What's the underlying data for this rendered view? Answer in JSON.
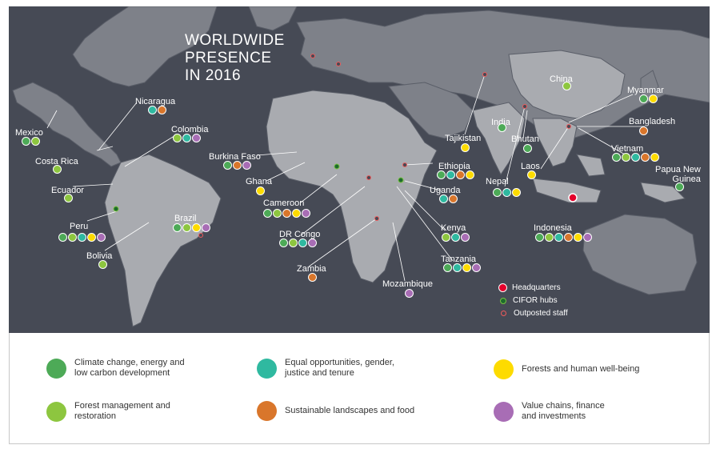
{
  "title": "WORLDWIDE\nPRESENCE\nIN 2016",
  "colors": {
    "climate": "#4daa57",
    "equal": "#2fb9a0",
    "wellbeing": "#fddb00",
    "forest": "#8dc63f",
    "landscapes": "#d9762b",
    "value": "#a86db5",
    "hq": "#e4002b"
  },
  "countries": [
    {
      "name": "Mexico",
      "themes": [
        "climate",
        "forest"
      ]
    },
    {
      "name": "Nicaragua",
      "themes": [
        "equal",
        "landscapes"
      ]
    },
    {
      "name": "Colombia",
      "themes": [
        "forest",
        "equal",
        "value"
      ]
    },
    {
      "name": "Costa Rica",
      "themes": [
        "forest"
      ]
    },
    {
      "name": "Ecuador",
      "themes": [
        "forest"
      ]
    },
    {
      "name": "Peru",
      "themes": [
        "climate",
        "forest",
        "equal",
        "wellbeing",
        "value"
      ]
    },
    {
      "name": "Bolivia",
      "themes": [
        "forest"
      ]
    },
    {
      "name": "Brazil",
      "themes": [
        "climate",
        "forest",
        "wellbeing",
        "value"
      ]
    },
    {
      "name": "Burkina Faso",
      "themes": [
        "climate",
        "landscapes",
        "value"
      ]
    },
    {
      "name": "Ghana",
      "themes": [
        "wellbeing"
      ]
    },
    {
      "name": "Cameroon",
      "themes": [
        "climate",
        "forest",
        "landscapes",
        "wellbeing",
        "value"
      ]
    },
    {
      "name": "DR Congo",
      "themes": [
        "climate",
        "forest",
        "equal",
        "value"
      ]
    },
    {
      "name": "Zambia",
      "themes": [
        "landscapes"
      ]
    },
    {
      "name": "Mozambique",
      "themes": [
        "value"
      ]
    },
    {
      "name": "Ethiopia",
      "themes": [
        "climate",
        "equal",
        "landscapes",
        "wellbeing"
      ]
    },
    {
      "name": "Uganda",
      "themes": [
        "equal",
        "landscapes"
      ]
    },
    {
      "name": "Kenya",
      "themes": [
        "forest",
        "equal",
        "value"
      ]
    },
    {
      "name": "Tanzania",
      "themes": [
        "climate",
        "equal",
        "wellbeing",
        "value"
      ]
    },
    {
      "name": "Tajikistan",
      "themes": [
        "wellbeing"
      ]
    },
    {
      "name": "India",
      "themes": [
        "climate"
      ]
    },
    {
      "name": "Nepal",
      "themes": [
        "climate",
        "equal",
        "wellbeing"
      ]
    },
    {
      "name": "Bhutan",
      "themes": [
        "climate"
      ]
    },
    {
      "name": "China",
      "themes": [
        "forest"
      ]
    },
    {
      "name": "Myanmar",
      "themes": [
        "climate",
        "wellbeing"
      ]
    },
    {
      "name": "Bangladesh",
      "themes": [
        "landscapes"
      ]
    },
    {
      "name": "Laos",
      "themes": [
        "wellbeing"
      ]
    },
    {
      "name": "Vietnam",
      "themes": [
        "climate",
        "forest",
        "equal",
        "landscapes",
        "wellbeing"
      ]
    },
    {
      "name": "Papua New\nGuinea",
      "themes": [
        "climate"
      ]
    },
    {
      "name": "Indonesia",
      "themes": [
        "climate",
        "forest",
        "equal",
        "landscapes",
        "wellbeing",
        "value"
      ]
    }
  ],
  "map_legend": {
    "hq": "Headquarters",
    "hubs": "CIFOR hubs",
    "staff": "Outposted staff"
  },
  "themes_legend": [
    {
      "key": "climate",
      "label": "Climate change, energy and\nlow carbon development"
    },
    {
      "key": "equal",
      "label": "Equal opportunities, gender,\njustice and tenure"
    },
    {
      "key": "wellbeing",
      "label": "Forests and human well-being"
    },
    {
      "key": "forest",
      "label": "Forest management and\nrestoration"
    },
    {
      "key": "landscapes",
      "label": "Sustainable landscapes and food"
    },
    {
      "key": "value",
      "label": "Value chains, finance\nand investments"
    }
  ]
}
